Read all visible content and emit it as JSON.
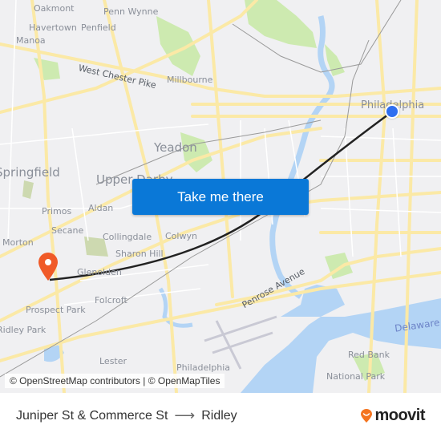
{
  "map": {
    "places": [
      {
        "name": "Oakmont",
        "size": "small"
      },
      {
        "name": "Penn Wynne",
        "size": "small"
      },
      {
        "name": "Havertown",
        "size": "small"
      },
      {
        "name": "Penfield",
        "size": "small"
      },
      {
        "name": "Manoa",
        "size": "small"
      },
      {
        "name": "Millbourne",
        "size": "small"
      },
      {
        "name": "Yeadon",
        "size": "big"
      },
      {
        "name": "Springfield",
        "size": "big"
      },
      {
        "name": "Upper Darby",
        "size": "big"
      },
      {
        "name": "Primos",
        "size": "small"
      },
      {
        "name": "Aldan",
        "size": "small"
      },
      {
        "name": "Secane",
        "size": "small"
      },
      {
        "name": "Collingdale",
        "size": "small"
      },
      {
        "name": "Colwyn",
        "size": "small"
      },
      {
        "name": "Sharon Hill",
        "size": "small"
      },
      {
        "name": "Morton",
        "size": "small"
      },
      {
        "name": "Glenolden",
        "size": "small"
      },
      {
        "name": "Folcroft",
        "size": "small"
      },
      {
        "name": "Prospect Park",
        "size": "small"
      },
      {
        "name": "Ridley Park",
        "size": "small"
      },
      {
        "name": "Lester",
        "size": "small"
      },
      {
        "name": "Philadelphia",
        "size": "big"
      },
      {
        "name": "Red Bank",
        "size": "small"
      },
      {
        "name": "National Park",
        "size": "small"
      },
      {
        "name": "Philadelphia",
        "size": "small"
      }
    ],
    "water_labels": [
      "Delaware R"
    ],
    "road_labels": [
      "West Chester Pike",
      "Penrose Avenue"
    ],
    "attribution": "© OpenStreetMap contributors | © OpenMapTiles",
    "cta_label": "Take me there",
    "colors": {
      "cta": "#0a78d7",
      "origin_marker": "#2f6ff0",
      "destination_marker": "#f05a28",
      "route": "#222222",
      "water": "#b3d4f5",
      "park": "#cdeab0",
      "road": "#fbe9a6"
    }
  },
  "footer": {
    "origin": "Juniper St & Commerce St",
    "arrow": "⟶",
    "destination": "Ridley",
    "brand": "moovit"
  }
}
